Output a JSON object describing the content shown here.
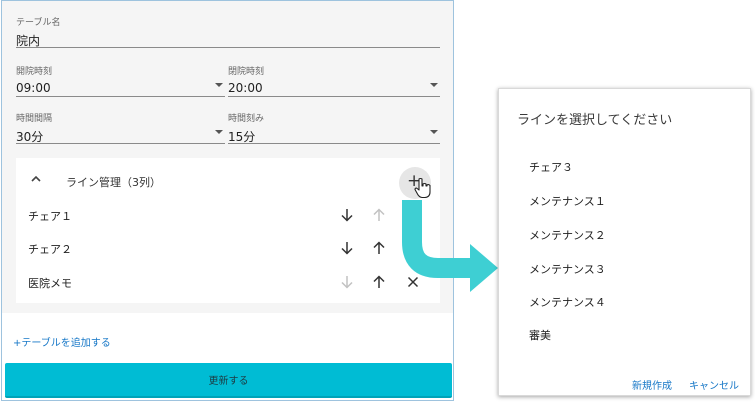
{
  "form": {
    "table_name_label": "テーブル名",
    "table_name_value": "院内",
    "open_label": "開院時刻",
    "open_value": "09:00",
    "close_label": "閉院時刻",
    "close_value": "20:00",
    "interval_label": "時間間隔",
    "interval_value": "30分",
    "step_label": "時間刻み",
    "step_value": "15分"
  },
  "line_card": {
    "title": "ライン管理（3列）",
    "add_symbol": "+",
    "rows": [
      {
        "label": "チェア１",
        "down_enabled": true,
        "up_enabled": false,
        "removable": false
      },
      {
        "label": "チェア２",
        "down_enabled": true,
        "up_enabled": true,
        "removable": false
      },
      {
        "label": "医院メモ",
        "down_enabled": false,
        "up_enabled": true,
        "removable": true
      }
    ]
  },
  "add_table_link": "+テーブルを追加する",
  "update_button": "更新する",
  "dialog": {
    "title": "ラインを選択してください",
    "options": [
      "チェア３",
      "メンテナンス１",
      "メンテナンス２",
      "メンテナンス３",
      "メンテナンス４",
      "審美"
    ],
    "new_button": "新規作成",
    "cancel_button": "キャンセル"
  },
  "colors": {
    "accent": "#00bcd4",
    "arrow": "#3ecfd3",
    "link": "#1677c7"
  }
}
